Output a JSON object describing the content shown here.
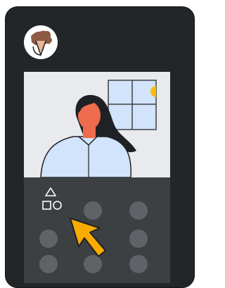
{
  "window": {
    "theme": "dark"
  },
  "user": {
    "avatar_icon": "user-avatar-illustration"
  },
  "video": {
    "participant_icon": "person-illustration",
    "background_icon": "window-with-sun"
  },
  "controls": {
    "shapes_icon": "shapes-icon",
    "cursor_icon": "pointer-cursor-icon",
    "accent_color": "#f9ab00",
    "dot_color": "#5f6368",
    "dot_count": 8
  }
}
